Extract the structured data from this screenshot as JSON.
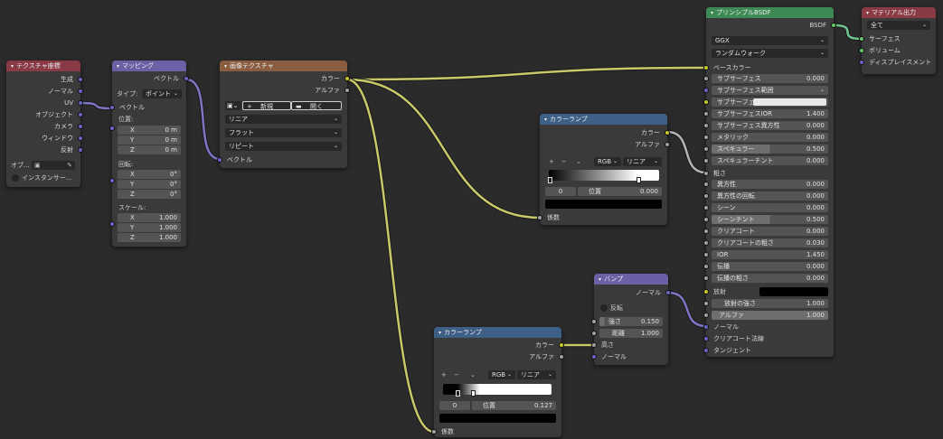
{
  "texcoord": {
    "title": "テクスチャ座標",
    "outputs": [
      "生成",
      "ノーマル",
      "UV",
      "オブジェクト",
      "カメラ",
      "ウィンドウ",
      "反射"
    ],
    "object_label": "オブ...",
    "instancer_label": "インスタンサー..."
  },
  "mapping": {
    "title": "マッピング",
    "output": "ベクトル",
    "type_label": "タイプ:",
    "type_value": "ポイント",
    "vector_input": "ベクトル",
    "location_label": "位置:",
    "location": [
      {
        "axis": "X",
        "value": "0 m"
      },
      {
        "axis": "Y",
        "value": "0 m"
      },
      {
        "axis": "Z",
        "value": "0 m"
      }
    ],
    "rotation_label": "回転:",
    "rotation": [
      {
        "axis": "X",
        "value": "0°"
      },
      {
        "axis": "Y",
        "value": "0°"
      },
      {
        "axis": "Z",
        "value": "0°"
      }
    ],
    "scale_label": "スケール:",
    "scale": [
      {
        "axis": "X",
        "value": "1.000"
      },
      {
        "axis": "Y",
        "value": "1.000"
      },
      {
        "axis": "Z",
        "value": "1.000"
      }
    ]
  },
  "imagetex": {
    "title": "画像テクスチャ",
    "outputs": [
      "カラー",
      "アルファ"
    ],
    "new_label": "新規",
    "open_label": "開く",
    "interpolation": "リニア",
    "projection": "フラット",
    "extension": "リピート",
    "vector_input": "ベクトル"
  },
  "ramp1": {
    "title": "カラーランプ",
    "outputs": [
      "カラー",
      "アルファ"
    ],
    "mode": "RGB",
    "interp": "リニア",
    "index": "0",
    "pos_label": "位置",
    "pos_value": "0.000",
    "input": "係数"
  },
  "ramp2": {
    "title": "カラーランプ",
    "outputs": [
      "カラー",
      "アルファ"
    ],
    "mode": "RGB",
    "interp": "リニア",
    "index": "0",
    "pos_label": "位置",
    "pos_value": "0.127",
    "input": "係数"
  },
  "bump": {
    "title": "バンプ",
    "output": "ノーマル",
    "invert_label": "反転",
    "strength_label": "強さ",
    "strength_value": "0.150",
    "distance_label": "距離",
    "distance_value": "1.000",
    "inputs": [
      "高さ",
      "ノーマル"
    ]
  },
  "bsdf": {
    "title": "プリンシプルBSDF",
    "output": "BSDF",
    "distribution": "GGX",
    "sss_method": "ランダムウォーク",
    "base_color_label": "ベースカラー",
    "params": [
      {
        "label": "サブサーフェス",
        "value": "0.000"
      },
      {
        "label": "サブサーフェス範囲",
        "value": "",
        "dropdown": true
      },
      {
        "label": "サブサーフェ...",
        "value": "",
        "swatch": "#e8e8e8"
      },
      {
        "label": "サブサーフェスIOR",
        "value": "1.400"
      },
      {
        "label": "サブサーフェス異方性",
        "value": "0.000"
      },
      {
        "label": "メタリック",
        "value": "0.000"
      },
      {
        "label": "スペキュラー",
        "value": "0.500",
        "fill": 0.5
      },
      {
        "label": "スペキュラーチント",
        "value": "0.000"
      }
    ],
    "roughness_label": "粗さ",
    "params2": [
      {
        "label": "異方性",
        "value": "0.000"
      },
      {
        "label": "異方性の回転",
        "value": "0.000"
      },
      {
        "label": "シーン",
        "value": "0.000"
      },
      {
        "label": "シーンチント",
        "value": "0.500",
        "fill": 0.5
      },
      {
        "label": "クリアコート",
        "value": "0.000"
      },
      {
        "label": "クリアコートの粗さ",
        "value": "0.030"
      },
      {
        "label": "IOR",
        "value": "1.450"
      },
      {
        "label": "伝播",
        "value": "0.000"
      },
      {
        "label": "伝播の粗さ",
        "value": "0.000"
      }
    ],
    "emission_label": "放射",
    "emission_strength_label": "放射の強さ",
    "emission_strength_value": "1.000",
    "alpha_label": "アルファ",
    "alpha_value": "1.000",
    "inputs_bottom": [
      "ノーマル",
      "クリアコート法線",
      "タンジェント"
    ]
  },
  "output": {
    "title": "マテリアル出力",
    "target": "全て",
    "inputs": [
      "サーフェス",
      "ボリューム",
      "ディスプレイスメント"
    ]
  },
  "colors": {
    "vector_socket": "#6a64c4",
    "color_socket": "#c7c729",
    "value_socket": "#a1a1a1",
    "shader_socket": "#63c763",
    "wire_color": "#c9c96a",
    "wire_vector": "#7c76c4",
    "wire_shader": "#72c795",
    "wire_gray": "#b5b5b5"
  }
}
